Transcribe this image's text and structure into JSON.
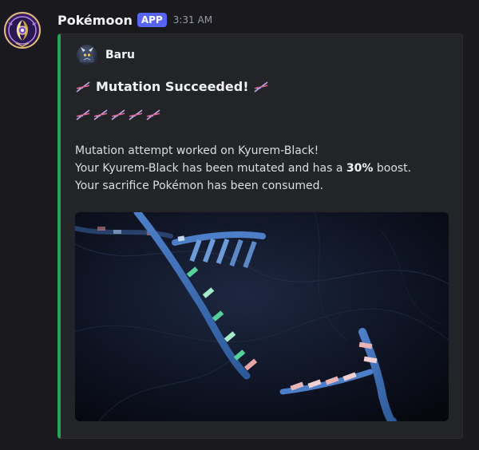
{
  "message": {
    "bot_name": "Pokémoon",
    "app_badge": "APP",
    "timestamp": "3:31 AM",
    "avatar_icon": "pokemoon-bot-avatar-icon"
  },
  "embed": {
    "accent_color": "#23a55a",
    "author": {
      "name": "Baru",
      "avatar_icon": "kyurem-black-avatar-icon"
    },
    "title": "Mutation Succeeded!",
    "title_emoji": "dna-emoji",
    "dna_emoji_row_count": 5,
    "description": {
      "line1": "Mutation attempt worked on Kyurem-Black!",
      "line2_prefix": "Your Kyurem-Black has been mutated and has a ",
      "line2_bold": "30%",
      "line2_suffix": " boost.",
      "line3": "Your sacrifice Pokémon has been consumed."
    },
    "image": {
      "subject": "dna-helix-image"
    }
  },
  "colors": {
    "background": "#1a1a1e",
    "embed_background": "#232428",
    "app_badge": "#5865f2",
    "timestamp": "#949ba4"
  }
}
